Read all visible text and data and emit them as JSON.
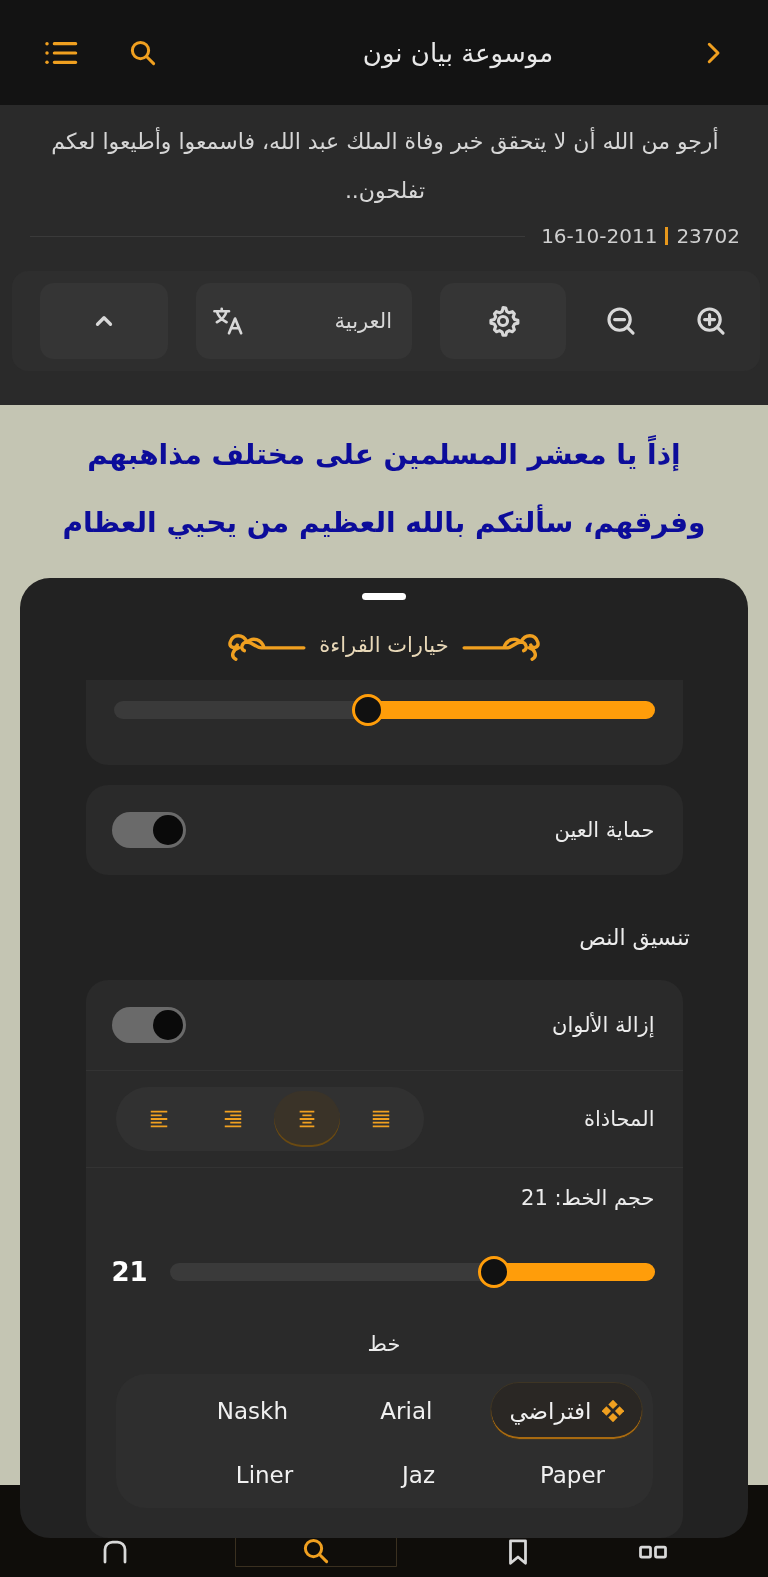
{
  "header": {
    "title": "موسوعة بيان نون"
  },
  "article": {
    "text": "أرجو من الله أن لا يتحقق خبر وفاة الملك عبد الله، فاسمعوا وأطيعوا لعكم تفلحون..",
    "views": "23702",
    "date": "16-10-2011"
  },
  "toolbar": {
    "language": "العربية"
  },
  "content": {
    "text": "إذاً يا معشر المسلمين على مختلف مذاهبهم وفرقهم، سألتكم بالله العظيم من يحيي العظام"
  },
  "sheet": {
    "title": "خيارات القراءة",
    "brightness": {
      "level": 0.5
    },
    "eye_protection": {
      "label": "حماية العين",
      "on": true
    },
    "section_title": "تنسيق النص",
    "remove_colors": {
      "label": "إزالة الألوان",
      "on": true
    },
    "alignment": {
      "label": "المحاذاة",
      "options": [
        {
          "kind": "justify",
          "selected": false
        },
        {
          "kind": "center",
          "selected": true
        },
        {
          "kind": "right",
          "selected": false
        },
        {
          "kind": "left",
          "selected": false
        }
      ]
    },
    "font_size": {
      "label": "حجم الخط: 21",
      "value": "21",
      "level": 0.31
    },
    "font": {
      "label": "خط",
      "options": [
        {
          "label": "افتراضي",
          "selected": true
        },
        {
          "label": "Arial",
          "selected": false
        },
        {
          "label": "Naskh",
          "selected": false
        },
        {
          "label": "Paper",
          "selected": false
        },
        {
          "label": "Jaz",
          "selected": false
        },
        {
          "label": "Liner",
          "selected": false
        }
      ]
    }
  }
}
